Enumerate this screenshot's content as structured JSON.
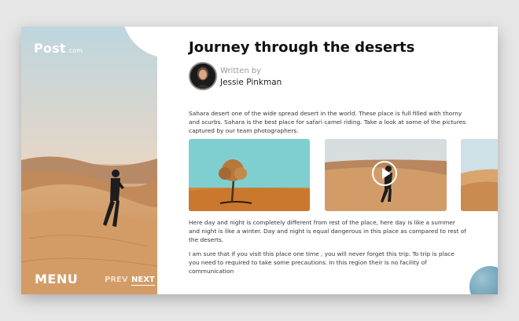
{
  "brand": {
    "name": "Post",
    "suffix": ".com"
  },
  "nav": {
    "menu_label": "MENU",
    "prev_label": "PREV",
    "next_label": "NEXT"
  },
  "article": {
    "title": "Journey through the deserts",
    "written_by_label": "Written by",
    "author": "Jessie Pinkman",
    "paragraphs": [
      "Sahara desert one of the wide spread desert in the world. These place is full filled with thorny and scurbs. Sahara is the best place for safari camel riding. Take a look at some of the pictures captured by our team photographers.",
      "Here day and night is completely different from rest of the place, here day is like a summer and night is like a winter. Day and night is equal dangerous in this place as compared to rest of the deserts.",
      "I am sure that if you visit this place one time , you will never forget this trip. To trip is place you need to required to take some precautions. In this region their is no facility of communication"
    ]
  },
  "gallery": {
    "items": [
      {
        "icon": "tree-photo"
      },
      {
        "icon": "play-icon"
      },
      {
        "icon": "desert-photo"
      }
    ]
  },
  "colors": {
    "accent_blue": "#6fa3bb",
    "sand": "#d39c66",
    "sky": "#7fcfd0"
  }
}
